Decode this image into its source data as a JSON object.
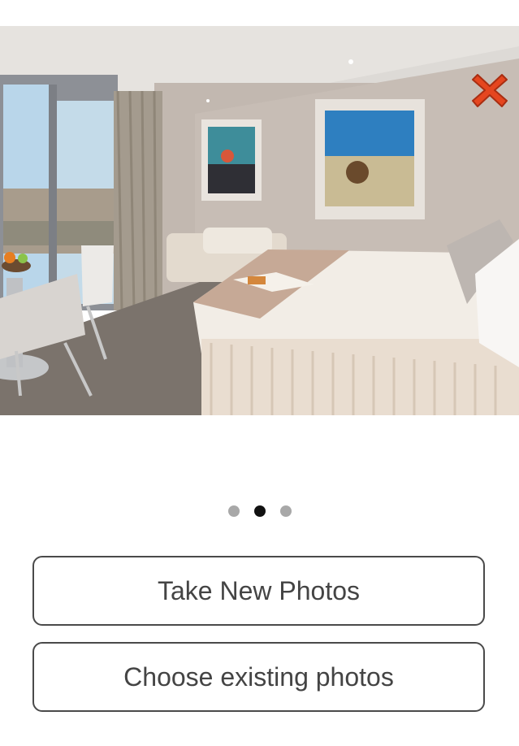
{
  "photo": {
    "icon": "room-photo",
    "close_icon": "close-icon",
    "close_color": "#e5461f"
  },
  "pager": {
    "page_count": 3,
    "current_page": 2
  },
  "actions": {
    "take_new_label": "Take New Photos",
    "choose_existing_label": "Choose existing photos"
  }
}
